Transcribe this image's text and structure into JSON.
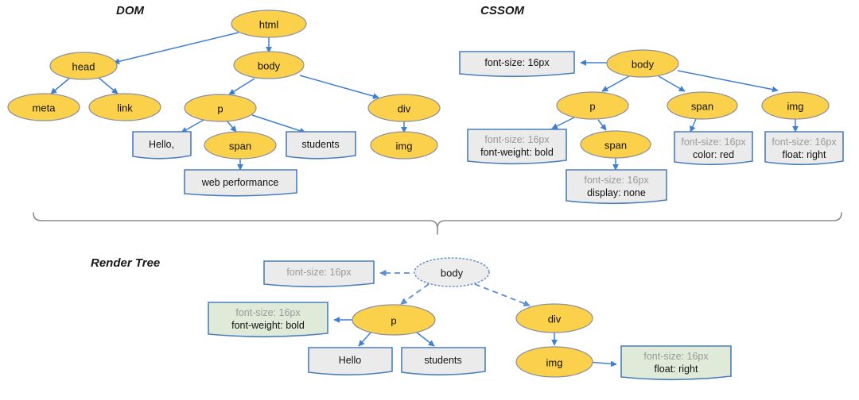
{
  "sections": {
    "dom": {
      "title": "DOM"
    },
    "cssom": {
      "title": "CSSOM"
    },
    "render": {
      "title": "Render Tree"
    }
  },
  "dom_tree": {
    "nodes": [
      {
        "id": "html",
        "label": "html",
        "type": "element"
      },
      {
        "id": "head",
        "label": "head",
        "type": "element"
      },
      {
        "id": "body",
        "label": "body",
        "type": "element"
      },
      {
        "id": "meta",
        "label": "meta",
        "type": "element"
      },
      {
        "id": "link",
        "label": "link",
        "type": "element"
      },
      {
        "id": "p",
        "label": "p",
        "type": "element"
      },
      {
        "id": "div",
        "label": "div",
        "type": "element"
      },
      {
        "id": "span",
        "label": "span",
        "type": "element"
      },
      {
        "id": "img",
        "label": "img",
        "type": "element"
      }
    ],
    "text_nodes": [
      {
        "id": "hello",
        "label": "Hello,"
      },
      {
        "id": "students",
        "label": "students"
      },
      {
        "id": "webperf",
        "label": "web performance"
      }
    ],
    "edges": [
      [
        "html",
        "head"
      ],
      [
        "html",
        "body"
      ],
      [
        "head",
        "meta"
      ],
      [
        "head",
        "link"
      ],
      [
        "body",
        "p"
      ],
      [
        "body",
        "div"
      ],
      [
        "p",
        "hello"
      ],
      [
        "p",
        "span"
      ],
      [
        "p",
        "students"
      ],
      [
        "span",
        "webperf"
      ],
      [
        "div",
        "img"
      ]
    ]
  },
  "cssom_tree": {
    "nodes": [
      {
        "id": "body",
        "label": "body"
      },
      {
        "id": "p",
        "label": "p"
      },
      {
        "id": "span",
        "label": "span"
      },
      {
        "id": "img",
        "label": "img"
      },
      {
        "id": "span2",
        "label": "span"
      }
    ],
    "style_boxes": [
      {
        "id": "body-style",
        "inherited": "font-size: 16px",
        "own": ""
      },
      {
        "id": "p-style",
        "inherited": "font-size: 16px",
        "own": "font-weight: bold"
      },
      {
        "id": "span2-style",
        "inherited": "font-size: 16px",
        "own": "display: none"
      },
      {
        "id": "span-style",
        "inherited": "font-size: 16px",
        "own": "color: red"
      },
      {
        "id": "img-style",
        "inherited": "font-size: 16px",
        "own": "float: right"
      }
    ],
    "edges": [
      [
        "body",
        "body-style"
      ],
      [
        "body",
        "p"
      ],
      [
        "body",
        "span"
      ],
      [
        "body",
        "img"
      ],
      [
        "p",
        "p-style"
      ],
      [
        "p",
        "span2"
      ],
      [
        "span2",
        "span2-style"
      ],
      [
        "span",
        "span-style"
      ],
      [
        "img",
        "img-style"
      ]
    ]
  },
  "render_tree": {
    "nodes": [
      {
        "id": "body",
        "label": "body",
        "type": "ghost"
      },
      {
        "id": "p",
        "label": "p",
        "type": "element"
      },
      {
        "id": "div",
        "label": "div",
        "type": "element"
      },
      {
        "id": "img",
        "label": "img",
        "type": "element"
      }
    ],
    "text_nodes": [
      {
        "id": "hello",
        "label": "Hello"
      },
      {
        "id": "students",
        "label": "students"
      }
    ],
    "style_boxes": [
      {
        "id": "body-style",
        "inherited": "font-size: 16px",
        "own": "",
        "highlight": false
      },
      {
        "id": "p-style",
        "inherited": "font-size: 16px",
        "own": "font-weight: bold",
        "highlight": true
      },
      {
        "id": "img-style",
        "inherited": "font-size: 16px",
        "own": "float: right",
        "highlight": true
      }
    ],
    "edges": [
      [
        "body",
        "body-style"
      ],
      [
        "body",
        "p"
      ],
      [
        "body",
        "div"
      ],
      [
        "p",
        "p-style"
      ],
      [
        "p",
        "hello"
      ],
      [
        "p",
        "students"
      ],
      [
        "div",
        "img"
      ],
      [
        "img",
        "img-style"
      ]
    ]
  },
  "colors": {
    "node_fill": "#fbd14b",
    "node_stroke": "#8a8f9e",
    "box_fill": "#ebebeb",
    "box_highlight_fill": "#dfead9",
    "box_stroke": "#4a7ebb",
    "edge": "#3f7fcf",
    "muted_text": "#9a9a9a",
    "brace": "#8c8c8c"
  }
}
